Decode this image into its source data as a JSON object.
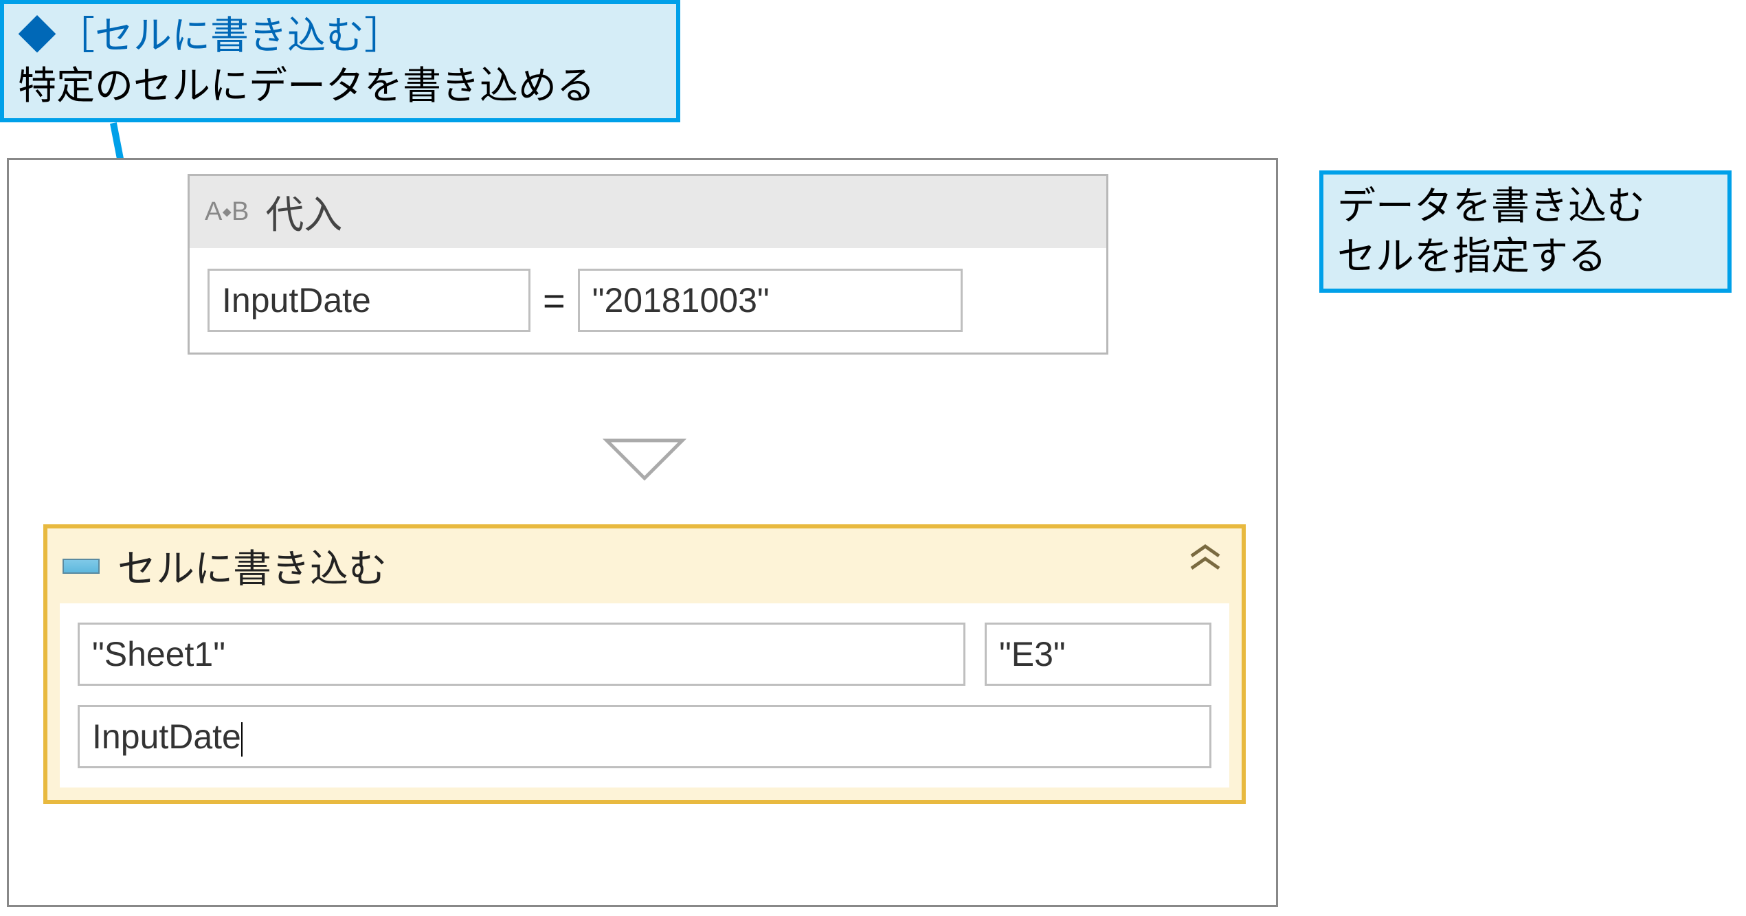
{
  "callouts": {
    "top": {
      "diamond": "◆",
      "bracket_label": "［セルに書き込む］",
      "desc": "特定のセルにデータを書き込める"
    },
    "right": {
      "line1": "データを書き込む",
      "line2": "セルを指定する"
    }
  },
  "assign": {
    "icon": "A⬩B",
    "title": "代入",
    "variable": "InputDate",
    "equals": "=",
    "value": "\"20181003\""
  },
  "write_cell": {
    "title": "セルに書き込む",
    "sheet": "\"Sheet1\"",
    "cell": "\"E3\"",
    "value": "InputDate"
  }
}
